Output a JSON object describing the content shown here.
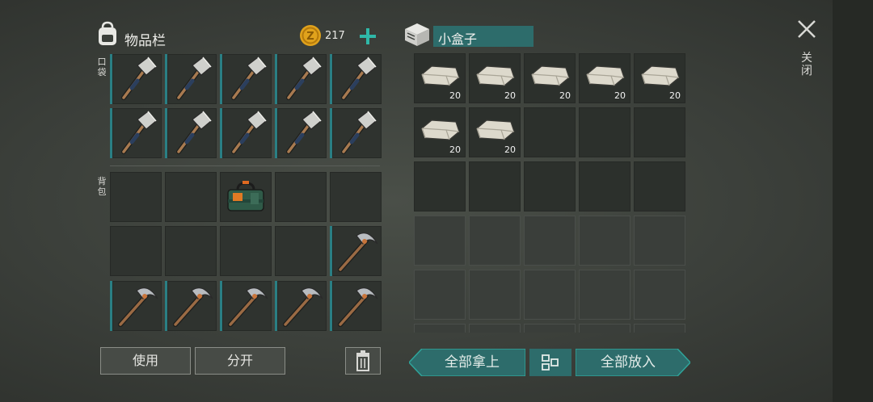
{
  "inventory": {
    "title": "物品栏",
    "coins": "217",
    "pocket_label": "口袋",
    "backpack_label": "背包",
    "use_button": "使用",
    "split_button": "分开"
  },
  "container": {
    "name": "小盒子",
    "stack_qty": "20",
    "take_all_button": "全部拿上",
    "put_all_button": "全部放入"
  },
  "close_label": "关闭",
  "colors": {
    "teal": "#2d6c6b",
    "accent_plus": "#2fb8a8",
    "coin": "#e0a21c"
  },
  "icons": {
    "backpack": "backpack-icon",
    "box": "box-icon",
    "coin": "coin-icon",
    "plus": "plus-icon",
    "close": "close-icon",
    "trash": "trash-icon",
    "sort": "sort-icon"
  }
}
